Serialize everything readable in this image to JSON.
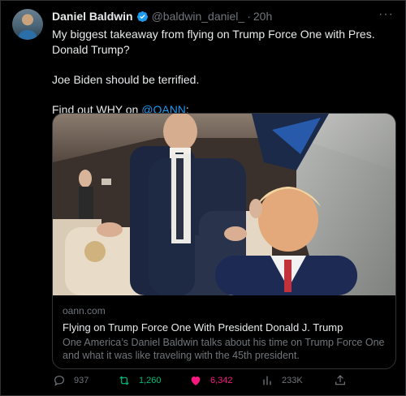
{
  "tweet": {
    "author_name": "Daniel Baldwin",
    "handle": "@baldwin_daniel_",
    "separator": "·",
    "time": "20h",
    "more": "···",
    "text_line1": "My biggest takeaway from flying on Trump Force One with Pres. Donald Trump?",
    "text_line2": "Joe Biden should be terrified.",
    "text_line3_prefix": "Find out WHY on ",
    "text_line3_mention": "@OANN",
    "text_line3_suffix": ":"
  },
  "card": {
    "domain": "oann.com",
    "title": "Flying on Trump Force One With President Donald J. Trump",
    "description": "One America’s Daniel Baldwin talks about his time on Trump Force One and what it was like traveling with the 45th president."
  },
  "actions": {
    "replies": "937",
    "retweets": "1,260",
    "likes": "6,342",
    "views": "233K"
  },
  "icons": {
    "verified": "verified-badge-icon",
    "reply": "reply-icon",
    "retweet": "retweet-icon",
    "like": "heart-icon",
    "views": "views-icon",
    "share": "share-icon"
  },
  "colors": {
    "background": "#000000",
    "text": "#e7e9ea",
    "muted": "#71767b",
    "link": "#1d9bf0",
    "retweet": "#00ba7c",
    "like": "#f91880"
  }
}
